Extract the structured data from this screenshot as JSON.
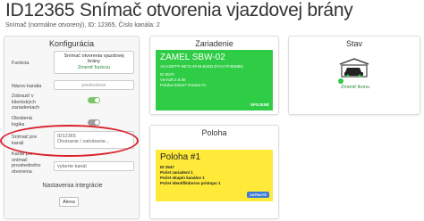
{
  "header": {
    "title": "ID12365 Snímač otvorenia vjazdovej brány",
    "subtitle": "Snímač (normálne otvorený), ID: 12365, Číslo kanála: 2"
  },
  "config": {
    "title": "Konfigurácia",
    "funkcia_label": "Funkcia",
    "funkcia_value_line1": "Snímač otvorenia vjazdovej",
    "funkcia_value_line2": "brány",
    "funkcia_link": "Zmeniť funkciu",
    "nazov_label": "Názov kanála",
    "nazov_value": "predvolene",
    "zobrazit_label_line1": "Zobraziť v",
    "zobrazit_label_line2": "klientských",
    "zobrazit_label_line3": "zariadeniach",
    "obratena_label_line1": "Obrátená",
    "obratena_label_line2": "logika",
    "snimac_label_line1": "Snímač pre",
    "snimac_label_line2": "kanál",
    "snimac_value_line1": "ID12365",
    "snimac_value_line2": "Otváranie / zatváranie...",
    "kanal_label_line1": "Kanál pre",
    "kanal_label_line2": "snímač",
    "kanal_label_line3": "prostredného",
    "kanal_label_line4": "otvorenia",
    "kanal_value": "vyberte kanál",
    "integrations_title": "Nastavenia integrácie",
    "alexa_button": "Alexa"
  },
  "device": {
    "title": "Zariadenie",
    "name": "ZAMEL SBW-02",
    "guid": "ACA32FFF-9E74-4F46-81ED-D7AA7F4E6961",
    "id_line": "ID 8570",
    "version_line": "VerSoft 2.8.58",
    "location_line": "Poloha ID2547 Poloha #1",
    "badge": "SPOJENÉ"
  },
  "status": {
    "title": "Stav",
    "link": "Zmeniť ikonu"
  },
  "location": {
    "title": "Poloha",
    "name": "Poloha #1",
    "id_line": "ID 2547",
    "devices_line": "Počet zariadení 1",
    "groups_line": "Počet skupín kanálov 1",
    "access_line": "Počet identifikátorov prístupu 1",
    "badge": "ZAPNUTÉ"
  }
}
